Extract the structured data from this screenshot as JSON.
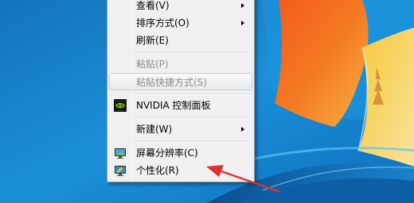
{
  "menu": {
    "view": {
      "label": "查看(V)"
    },
    "sort": {
      "label": "排序方式(O)"
    },
    "refresh": {
      "label": "刷新(E)"
    },
    "paste": {
      "label": "粘贴(P)"
    },
    "paste_shortcut": {
      "label": "粘贴快捷方式(S)"
    },
    "nvidia": {
      "label": "NVIDIA 控制面板",
      "icon": "nvidia-icon"
    },
    "new": {
      "label": "新建(W)"
    },
    "screen_resolution": {
      "label": "屏幕分辨率(C)",
      "icon": "monitor-icon"
    },
    "personalize": {
      "label": "个性化(R)",
      "icon": "personalize-monitor-icon"
    }
  },
  "colors": {
    "wallpaper_blue": "#1a8ad3",
    "annotation_arrow": "#e03030",
    "nvidia_green": "#76b900"
  }
}
